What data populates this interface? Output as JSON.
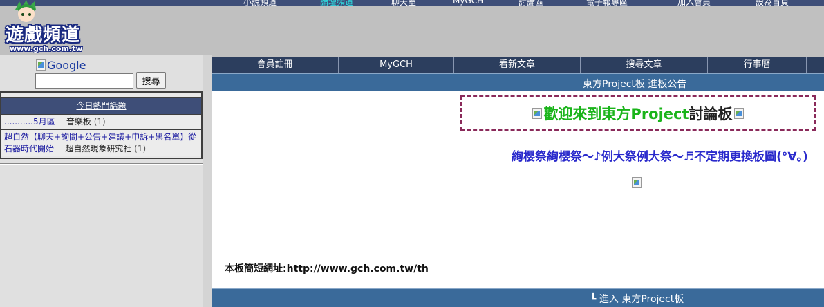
{
  "topnav": {
    "items": [
      {
        "label": "小說頻道"
      },
      {
        "label": "論壇頻道"
      },
      {
        "label": "聊天室"
      },
      {
        "label": "MyGCH"
      },
      {
        "label": "討論區"
      },
      {
        "label": "電子報專區"
      },
      {
        "label": "加入會員"
      },
      {
        "label": "設為首頁"
      }
    ]
  },
  "logo": {
    "title": "遊戲頻道",
    "url": "www.gch.com.tw"
  },
  "sidebar": {
    "google_alt": "Google",
    "search_value": "",
    "search_button": "搜尋",
    "hot_topics": {
      "title": "今日熱門話題",
      "rows": [
        {
          "link": "...........5月區",
          "sep": " -- ",
          "board": "音樂板",
          "count": " (1)"
        },
        {
          "link": "超自然【聊天+詢問+公告+建議+申訴+黑名單】從石器時代開始",
          "sep": " -- ",
          "board": "超自然現象研究社",
          "count": " (1)"
        }
      ]
    }
  },
  "main": {
    "nav": [
      {
        "label": "會員註冊"
      },
      {
        "label": "MyGCH"
      },
      {
        "label": "看新文章"
      },
      {
        "label": "搜尋文章"
      },
      {
        "label": "行事曆"
      }
    ],
    "notice_title": "東方Project板 進板公告",
    "welcome_part1": "歡迎來到東方Project",
    "welcome_part2": "討論板",
    "subtitle": "絢櫻祭絢櫻祭～♪例大祭例大祭～♬不定期更換板圖(°∀。)",
    "short_url": "本板簡短網址:http://www.gch.com.tw/th",
    "enter_label": "┗ 進入 東方Project板"
  },
  "colors": {
    "nav_bg": "#2c3e5e",
    "bar_bg": "#3a6a9a",
    "welcome_green": "#1ab41a",
    "subtitle_blue": "#2a2acc",
    "dashed_border": "#8a2a5a"
  }
}
